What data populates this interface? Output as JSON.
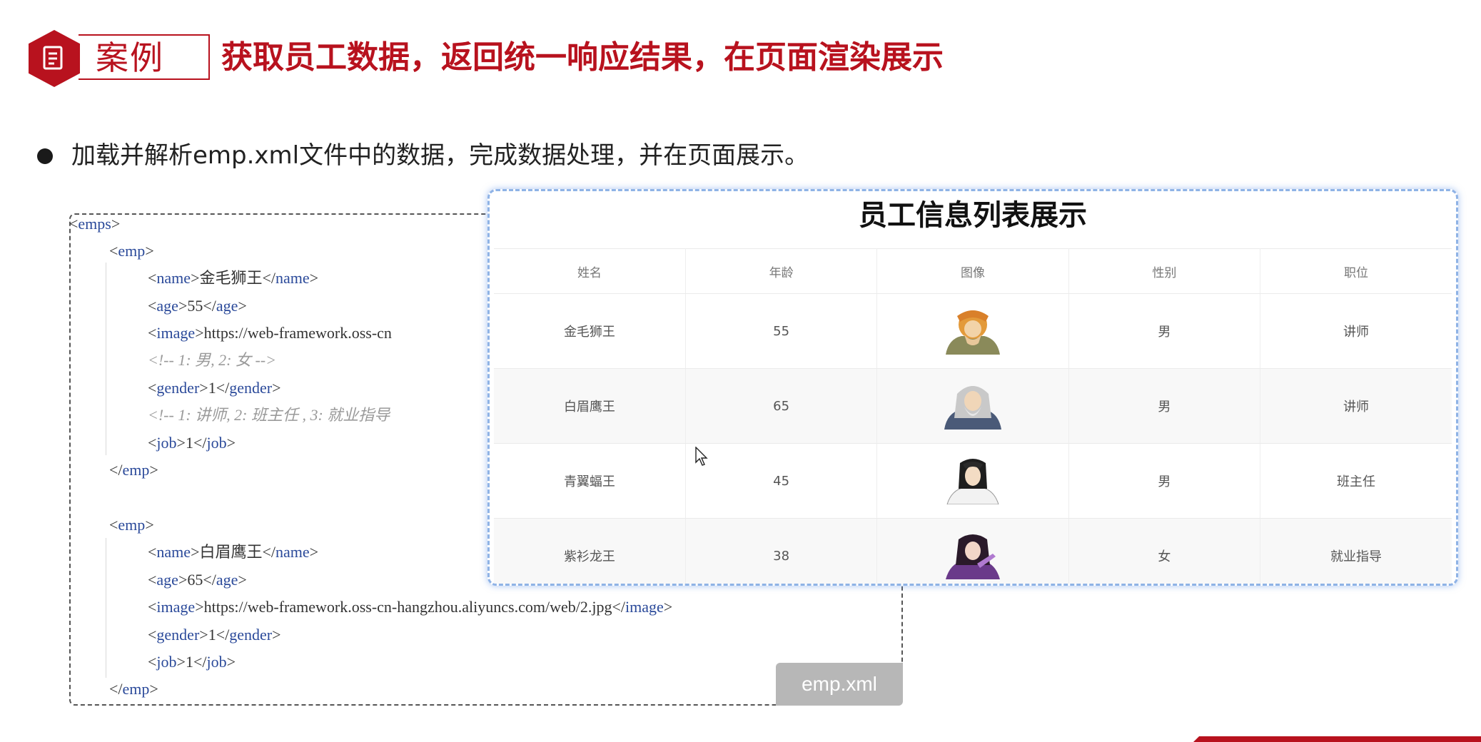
{
  "header": {
    "badge_label": "案例",
    "title": "获取员工数据，返回统一响应结果，在页面渲染展示",
    "accent_color": "#b8121e",
    "badge_icon": "document-icon"
  },
  "bullet": {
    "text": "加载并解析emp.xml文件中的数据，完成数据处理，并在页面展示。"
  },
  "code": {
    "file_label": "emp.xml",
    "lines": [
      {
        "parts": [
          [
            "t",
            "<"
          ],
          [
            "k",
            "emps"
          ],
          [
            "t",
            ">"
          ]
        ]
      },
      {
        "parts": [
          [
            "t",
            "<"
          ],
          [
            "k",
            "emp"
          ],
          [
            "t",
            ">"
          ]
        ]
      },
      {
        "parts": [
          [
            "t",
            "<"
          ],
          [
            "k",
            "name"
          ],
          [
            "t",
            ">金毛狮王</"
          ],
          [
            "k",
            "name"
          ],
          [
            "t",
            ">"
          ]
        ]
      },
      {
        "parts": [
          [
            "t",
            "<"
          ],
          [
            "k",
            "age"
          ],
          [
            "t",
            ">55</"
          ],
          [
            "k",
            "age"
          ],
          [
            "t",
            ">"
          ]
        ]
      },
      {
        "parts": [
          [
            "t",
            "<"
          ],
          [
            "k",
            "image"
          ],
          [
            "t",
            ">https://web-framework.oss-cn"
          ]
        ]
      },
      {
        "parts": [
          [
            "c",
            "<!-- 1: 男, 2: 女 -->"
          ]
        ]
      },
      {
        "parts": [
          [
            "t",
            "<"
          ],
          [
            "k",
            "gender"
          ],
          [
            "t",
            ">1</"
          ],
          [
            "k",
            "gender"
          ],
          [
            "t",
            ">"
          ]
        ]
      },
      {
        "parts": [
          [
            "c",
            "<!-- 1: 讲师, 2: 班主任 , 3: 就业指导"
          ]
        ]
      },
      {
        "parts": [
          [
            "t",
            "<"
          ],
          [
            "k",
            "job"
          ],
          [
            "t",
            ">1</"
          ],
          [
            "k",
            "job"
          ],
          [
            "t",
            ">"
          ]
        ]
      },
      {
        "parts": [
          [
            "t",
            "</"
          ],
          [
            "k",
            "emp"
          ],
          [
            "t",
            ">"
          ]
        ]
      },
      {
        "parts": [
          [
            "t",
            "<"
          ],
          [
            "k",
            "emp"
          ],
          [
            "t",
            ">"
          ]
        ]
      },
      {
        "parts": [
          [
            "t",
            "<"
          ],
          [
            "k",
            "name"
          ],
          [
            "t",
            ">白眉鹰王</"
          ],
          [
            "k",
            "name"
          ],
          [
            "t",
            ">"
          ]
        ]
      },
      {
        "parts": [
          [
            "t",
            "<"
          ],
          [
            "k",
            "age"
          ],
          [
            "t",
            ">65</"
          ],
          [
            "k",
            "age"
          ],
          [
            "t",
            ">"
          ]
        ]
      },
      {
        "parts": [
          [
            "t",
            "<"
          ],
          [
            "k",
            "image"
          ],
          [
            "t",
            ">https://web-framework.oss-cn-hangzhou.aliyuncs.com/web/2.jpg</"
          ],
          [
            "k",
            "image"
          ],
          [
            "t",
            ">"
          ]
        ]
      },
      {
        "parts": [
          [
            "t",
            "<"
          ],
          [
            "k",
            "gender"
          ],
          [
            "t",
            ">1</"
          ],
          [
            "k",
            "gender"
          ],
          [
            "t",
            ">"
          ]
        ]
      },
      {
        "parts": [
          [
            "t",
            "<"
          ],
          [
            "k",
            "job"
          ],
          [
            "t",
            ">1</"
          ],
          [
            "k",
            "job"
          ],
          [
            "t",
            ">"
          ]
        ]
      },
      {
        "parts": [
          [
            "t",
            "</"
          ],
          [
            "k",
            "emp"
          ],
          [
            "t",
            ">"
          ]
        ]
      }
    ]
  },
  "table_card": {
    "title": "员工信息列表展示",
    "columns": [
      "姓名",
      "年龄",
      "图像",
      "性别",
      "职位"
    ],
    "rows": [
      {
        "name": "金毛狮王",
        "age": "55",
        "gender": "男",
        "job": "讲师"
      },
      {
        "name": "白眉鹰王",
        "age": "65",
        "gender": "男",
        "job": "讲师"
      },
      {
        "name": "青翼蝠王",
        "age": "45",
        "gender": "男",
        "job": "班主任"
      },
      {
        "name": "紫衫龙王",
        "age": "38",
        "gender": "女",
        "job": "就业指导"
      }
    ],
    "border_color": "#8fb3e6"
  }
}
